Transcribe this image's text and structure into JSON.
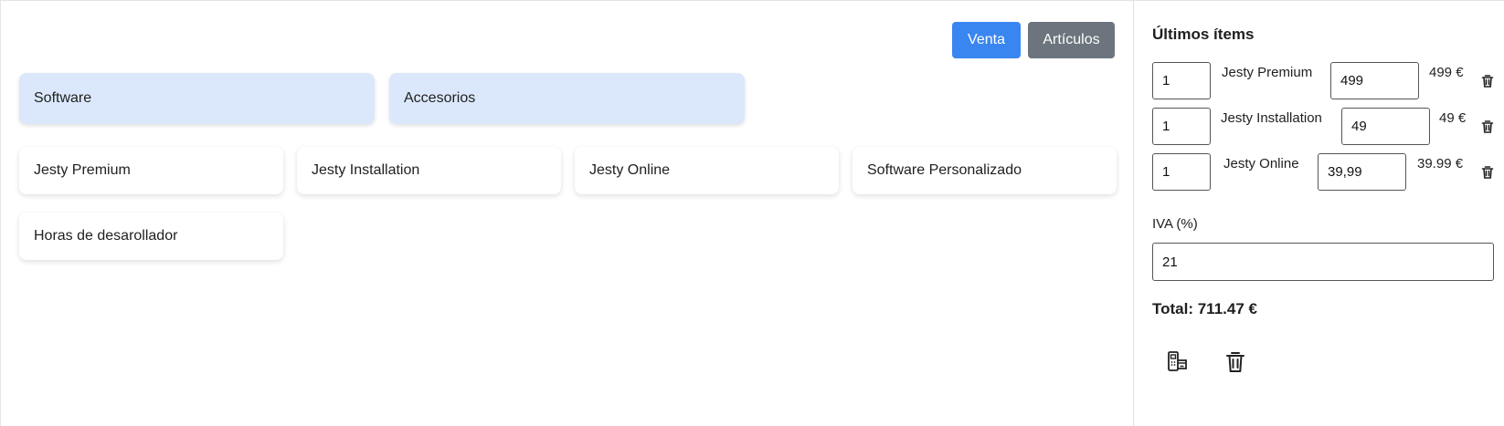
{
  "toolbar": {
    "venta_label": "Venta",
    "articulos_label": "Artículos"
  },
  "categories": [
    "Software",
    "Accesorios"
  ],
  "products": [
    "Jesty Premium",
    "Jesty Installation",
    "Jesty Online",
    "Software Personalizado",
    "Horas de desarollador"
  ],
  "sidebar": {
    "title": "Últimos ítems",
    "items": [
      {
        "qty": "1",
        "name": "Jesty Premium",
        "price": "499",
        "total": "499 €"
      },
      {
        "qty": "1",
        "name": "Jesty Installation",
        "price": "49",
        "total": "49 €"
      },
      {
        "qty": "1",
        "name": "Jesty Online",
        "price": "39,99",
        "total": "39.99 €"
      }
    ],
    "iva_label": "IVA (%)",
    "iva_value": "21",
    "total": "Total: 711.47 €"
  },
  "icons": {
    "item_delete": "trash-icon",
    "pay": "payment-terminal-icon",
    "clear": "trash-icon"
  },
  "colors": {
    "primary": "#3a86f0",
    "secondary": "#6c757d",
    "category_bg": "#dbe8fb"
  }
}
